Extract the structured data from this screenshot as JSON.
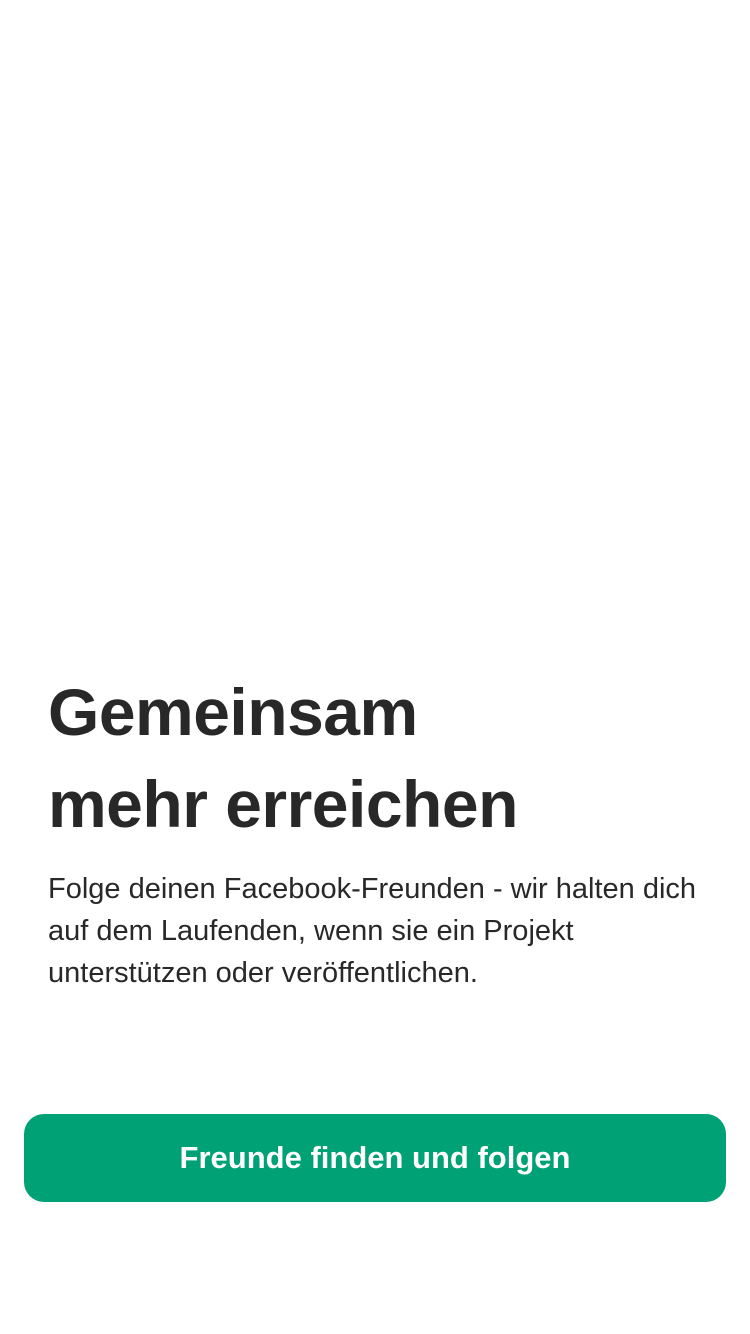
{
  "onboarding": {
    "title_line1": "Gemeinsam",
    "title_line2": "mehr erreichen",
    "description": "Folge deinen Facebook-Freunden - wir halten dich auf dem Laufenden, wenn sie ein Projekt unterstützen oder veröffentlichen.",
    "cta_label": "Freunde finden und folgen"
  },
  "colors": {
    "accent": "#00A275",
    "text": "#282828",
    "background": "#FFFFFF"
  }
}
